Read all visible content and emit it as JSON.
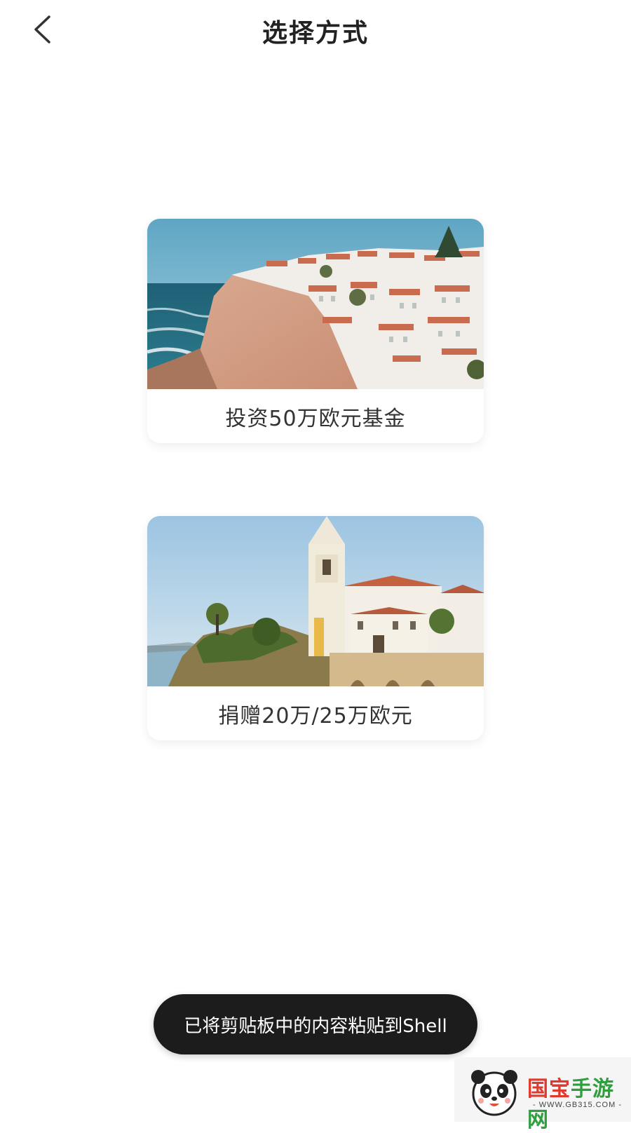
{
  "header": {
    "title": "选择方式",
    "back_icon": "chevron-left-icon"
  },
  "options": [
    {
      "label": "投资50万欧元基金",
      "image": "coastal-cliff-town-photo"
    },
    {
      "label": "捐赠20万/25万欧元",
      "image": "church-tower-seaside-photo"
    }
  ],
  "toast": {
    "text": "已将剪贴板中的内容粘贴到Shell"
  },
  "watermark": {
    "name_part1": "国宝",
    "name_part2": "手游网",
    "url": "- WWW.GB315.COM -",
    "colors": {
      "green": "#2e9e3e",
      "red": "#e03a2f"
    }
  }
}
